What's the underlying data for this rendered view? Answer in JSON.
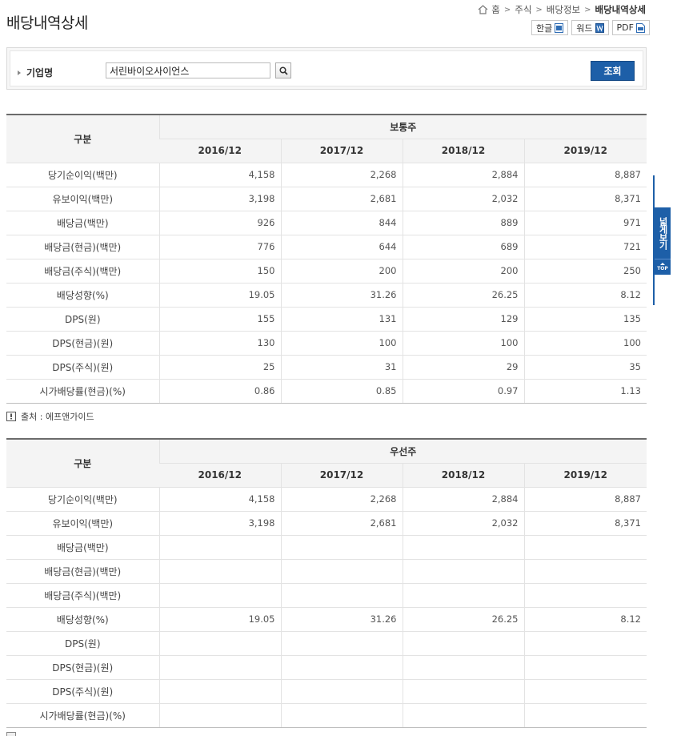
{
  "page": {
    "title": "배당내역상세"
  },
  "breadcrumb": {
    "items": [
      "홈",
      "주식",
      "배당정보",
      "배당내역상세"
    ],
    "separator": ">"
  },
  "doc_buttons": [
    {
      "label": "한글",
      "icon": "hwp-icon"
    },
    {
      "label": "워드",
      "icon": "word-icon"
    },
    {
      "label": "PDF",
      "icon": "pdf-icon"
    }
  ],
  "search": {
    "label": "기업명",
    "value": "서린바이오사이언스",
    "submit_label": "조회"
  },
  "common": {
    "row_header": "구분",
    "group_label": "보통주",
    "years": [
      "2016/12",
      "2017/12",
      "2018/12",
      "2019/12"
    ],
    "rows": [
      {
        "label": "당기순이익(백만)",
        "values": [
          "4,158",
          "2,268",
          "2,884",
          "8,887"
        ]
      },
      {
        "label": "유보이익(백만)",
        "values": [
          "3,198",
          "2,681",
          "2,032",
          "8,371"
        ]
      },
      {
        "label": "배당금(백만)",
        "values": [
          "926",
          "844",
          "889",
          "971"
        ]
      },
      {
        "label": "배당금(현금)(백만)",
        "values": [
          "776",
          "644",
          "689",
          "721"
        ]
      },
      {
        "label": "배당금(주식)(백만)",
        "values": [
          "150",
          "200",
          "200",
          "250"
        ]
      },
      {
        "label": "배당성향(%)",
        "values": [
          "19.05",
          "31.26",
          "26.25",
          "8.12"
        ]
      },
      {
        "label": "DPS(원)",
        "values": [
          "155",
          "131",
          "129",
          "135"
        ]
      },
      {
        "label": "DPS(현금)(원)",
        "values": [
          "130",
          "100",
          "100",
          "100"
        ]
      },
      {
        "label": "DPS(주식)(원)",
        "values": [
          "25",
          "31",
          "29",
          "35"
        ]
      },
      {
        "label": "시가배당률(현금)(%)",
        "values": [
          "0.86",
          "0.85",
          "0.97",
          "1.13"
        ]
      }
    ]
  },
  "source": {
    "text": "출처 : 에프앤가이드"
  },
  "preferred": {
    "row_header": "구분",
    "group_label": "우선주",
    "years": [
      "2016/12",
      "2017/12",
      "2018/12",
      "2019/12"
    ],
    "rows": [
      {
        "label": "당기순이익(백만)",
        "values": [
          "4,158",
          "2,268",
          "2,884",
          "8,887"
        ]
      },
      {
        "label": "유보이익(백만)",
        "values": [
          "3,198",
          "2,681",
          "2,032",
          "8,371"
        ]
      },
      {
        "label": "배당금(백만)",
        "values": [
          "",
          "",
          "",
          ""
        ]
      },
      {
        "label": "배당금(현금)(백만)",
        "values": [
          "",
          "",
          "",
          ""
        ]
      },
      {
        "label": "배당금(주식)(백만)",
        "values": [
          "",
          "",
          "",
          ""
        ]
      },
      {
        "label": "배당성향(%)",
        "values": [
          "19.05",
          "31.26",
          "26.25",
          "8.12"
        ]
      },
      {
        "label": "DPS(원)",
        "values": [
          "",
          "",
          "",
          ""
        ]
      },
      {
        "label": "DPS(현금)(원)",
        "values": [
          "",
          "",
          "",
          ""
        ]
      },
      {
        "label": "DPS(주식)(원)",
        "values": [
          "",
          "",
          "",
          ""
        ]
      },
      {
        "label": "시가배당률(현금)(%)",
        "values": [
          "",
          "",
          "",
          ""
        ]
      }
    ]
  },
  "side_tab": {
    "wide_label": "넓게보기",
    "top_label": "TOP"
  },
  "colors": {
    "accent": "#1d5fa8",
    "header_bg": "#f4f4f4",
    "border": "#e3e3e3"
  }
}
